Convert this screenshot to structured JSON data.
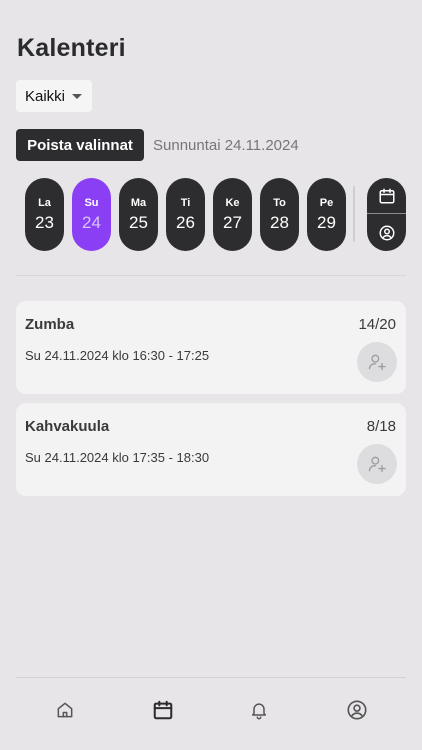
{
  "header": {
    "title": "Kalenteri"
  },
  "filter": {
    "selected": "Kaikki"
  },
  "actions": {
    "clear_label": "Poista valinnat",
    "selected_date_text": "Sunnuntai 24.11.2024"
  },
  "days": [
    {
      "name": "La",
      "date": "23",
      "selected": false
    },
    {
      "name": "Su",
      "date": "24",
      "selected": true
    },
    {
      "name": "Ma",
      "date": "25",
      "selected": false
    },
    {
      "name": "Ti",
      "date": "26",
      "selected": false
    },
    {
      "name": "Ke",
      "date": "27",
      "selected": false
    },
    {
      "name": "To",
      "date": "28",
      "selected": false
    },
    {
      "name": "Pe",
      "date": "29",
      "selected": false
    }
  ],
  "events": [
    {
      "name": "Zumba",
      "count": "14/20",
      "time": "Su 24.11.2024 klo 16:30 - 17:25"
    },
    {
      "name": "Kahvakuula",
      "count": "8/18",
      "time": "Su 24.11.2024 klo 17:35 - 18:30"
    }
  ],
  "nav": {
    "items": [
      "home-icon",
      "calendar-icon",
      "bell-icon",
      "user-circle-icon"
    ],
    "active": "calendar-icon"
  },
  "colors": {
    "background": "#e7e5e7",
    "dark": "#2d2c2e",
    "accent": "#8a3ff5",
    "card": "#f4f3f4"
  }
}
